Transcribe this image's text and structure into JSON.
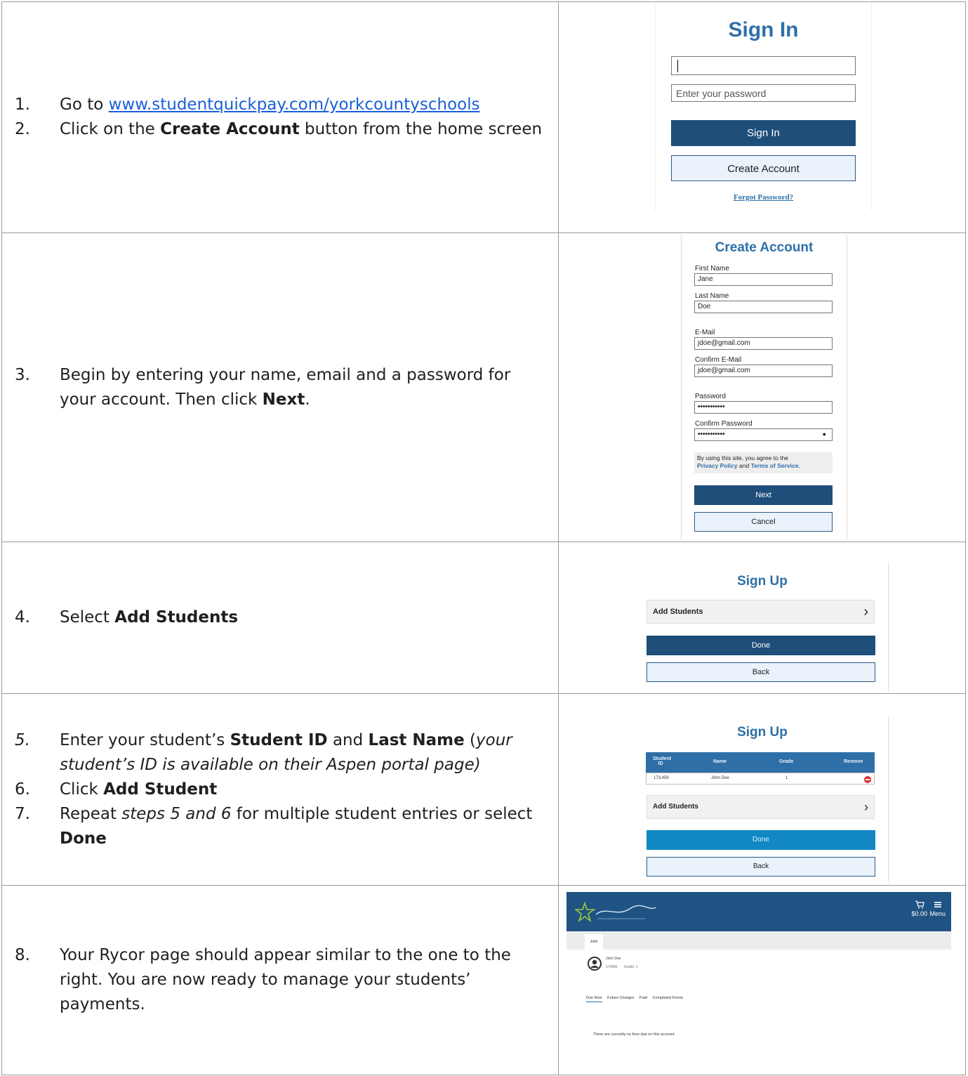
{
  "steps": {
    "s1_num": "1.",
    "s1_pre": "Go to ",
    "s1_link": "www.studentquickpay.com/yorkcountyschools",
    "s2_num": "2.",
    "s2_pre": "Click on the ",
    "s2_bold": "Create Account",
    "s2_post": " button from the home screen",
    "s3_num": "3.",
    "s3_pre": "Begin by entering your name, email and a password for your account. Then click ",
    "s3_bold": "Next",
    "s3_post": ".",
    "s4_num": "4.",
    "s4_pre": "Select ",
    "s4_bold": "Add Students",
    "s5_num": "5.",
    "s5_pre": "Enter your student’s ",
    "s5_b1": "Student ID",
    "s5_mid": " and ",
    "s5_b2": "Last Name",
    "s5_paren_open": " (",
    "s5_italic": "your student’s ID is available on their Aspen portal page)",
    "s6_num": "6.",
    "s6_pre": "Click ",
    "s6_bold": "Add Student",
    "s7_num": "7.",
    "s7_pre": "Repeat ",
    "s7_italic": "steps 5 and 6",
    "s7_mid": " for multiple student entries or select ",
    "s7_bold": "Done",
    "s8_num": "8.",
    "s8_text": "Your Rycor page should appear similar to the one to the right. You are now ready to manage your students’ payments."
  },
  "signin": {
    "title": "Sign In",
    "username_value": "",
    "password_placeholder": "Enter your password",
    "signin_button": "Sign In",
    "create_button": "Create Account",
    "forgot_link": "Forgot Password?"
  },
  "create_account": {
    "title": "Create Account",
    "first_name_label": "First Name",
    "first_name_value": "Jane",
    "last_name_label": "Last Name",
    "last_name_value": "Doe",
    "email_label": "E-Mail",
    "email_value": "jdoe@gmail.com",
    "confirm_email_label": "Confirm E-Mail",
    "confirm_email_value": "jdoe@gmail.com",
    "password_label": "Password",
    "password_value": "•••••••••••",
    "confirm_password_label": "Confirm Password",
    "confirm_password_value": "•••••••••••",
    "agree_text": "By using this site, you agree to the",
    "privacy_link": "Privacy Policy",
    "and_text": " and ",
    "terms_link": "Terms of Service",
    "period": ".",
    "next_button": "Next",
    "cancel_button": "Cancel"
  },
  "signup1": {
    "title": "Sign Up",
    "add_students": "Add Students",
    "done_button": "Done",
    "back_button": "Back"
  },
  "signup2": {
    "title": "Sign Up",
    "col_student_id": "Student ID",
    "col_name": "Name",
    "col_grade": "Grade",
    "col_remove": "Remove",
    "row_id": "173,456",
    "row_name": "John Doe",
    "row_grade": "1",
    "add_students": "Add Students",
    "done_button": "Done",
    "back_button": "Back"
  },
  "rycor": {
    "cart_amount": "$0.00",
    "menu_label": "Menu",
    "tab_label": "John",
    "student_name": "John Doe",
    "student_id": "173456",
    "student_grade": "Grade: 1",
    "tab_due_now": "Due Now",
    "tab_future": "Future Charges",
    "tab_paid": "Paid",
    "tab_forms": "Completed Forms",
    "no_fees": "There are currently no fees due on this account."
  },
  "colors": {
    "primary_button": "#1f4e7a",
    "title_blue": "#2f6fa8",
    "done_teal": "#1188c4",
    "link_blue": "#1a5fd8",
    "header_blue": "#1f5384"
  }
}
